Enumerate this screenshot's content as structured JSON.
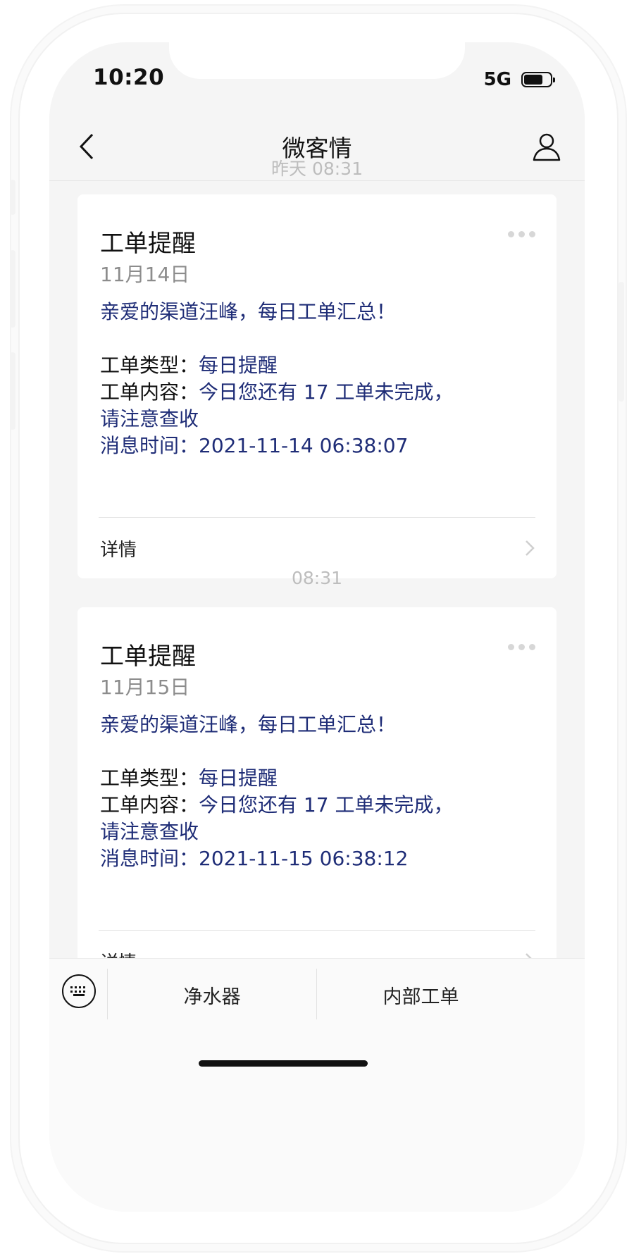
{
  "status_bar": {
    "time": "10:20",
    "network": "5G",
    "battery_level": 0.75
  },
  "nav": {
    "title": "微客情"
  },
  "messages": [
    {
      "timestamp": "昨天 08:31",
      "title": "工单提醒",
      "date": "11月14日",
      "greeting": "亲爱的渠道汪峰，每日工单汇总！",
      "type_label": "工单类型：",
      "type_value": "每日提醒",
      "content_label": "工单内容：",
      "content_value": "今日您还有 17 工单未完成，",
      "content_value_cont": "请注意查收",
      "time_label": "消息时间：",
      "time_value": "2021-11-14 06:38:07",
      "details_label": "详情"
    },
    {
      "timestamp": "08:31",
      "title": "工单提醒",
      "date": "11月15日",
      "greeting": "亲爱的渠道汪峰，每日工单汇总！",
      "type_label": "工单类型：",
      "type_value": "每日提醒",
      "content_label": "工单内容：",
      "content_value": "今日您还有 17 工单未完成，",
      "content_value_cont": "请注意查收",
      "time_label": "消息时间：",
      "time_value": "2021-11-15 06:38:12",
      "details_label": "详情"
    }
  ],
  "bottom_menu": {
    "items": [
      {
        "label": "净水器"
      },
      {
        "label": "内部工单"
      }
    ]
  },
  "icons": {
    "back": "chevron-left-icon",
    "profile": "person-icon",
    "more": "ellipsis-icon",
    "details": "chevron-right-icon",
    "keyboard": "keyboard-icon"
  },
  "colors": {
    "accent_text": "#1f2d77",
    "background": "#f5f5f5",
    "card": "#ffffff"
  }
}
